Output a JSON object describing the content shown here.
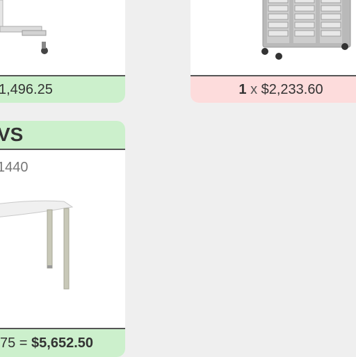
{
  "products": [
    {
      "price_line": "1,496.25"
    },
    {
      "quantity": "1",
      "multiplier": "x",
      "unit_price": "$2,233.60"
    },
    {
      "title": "VS",
      "sku": "1440",
      "price_prefix": "75 =",
      "total": "$5,652.50"
    }
  ]
}
